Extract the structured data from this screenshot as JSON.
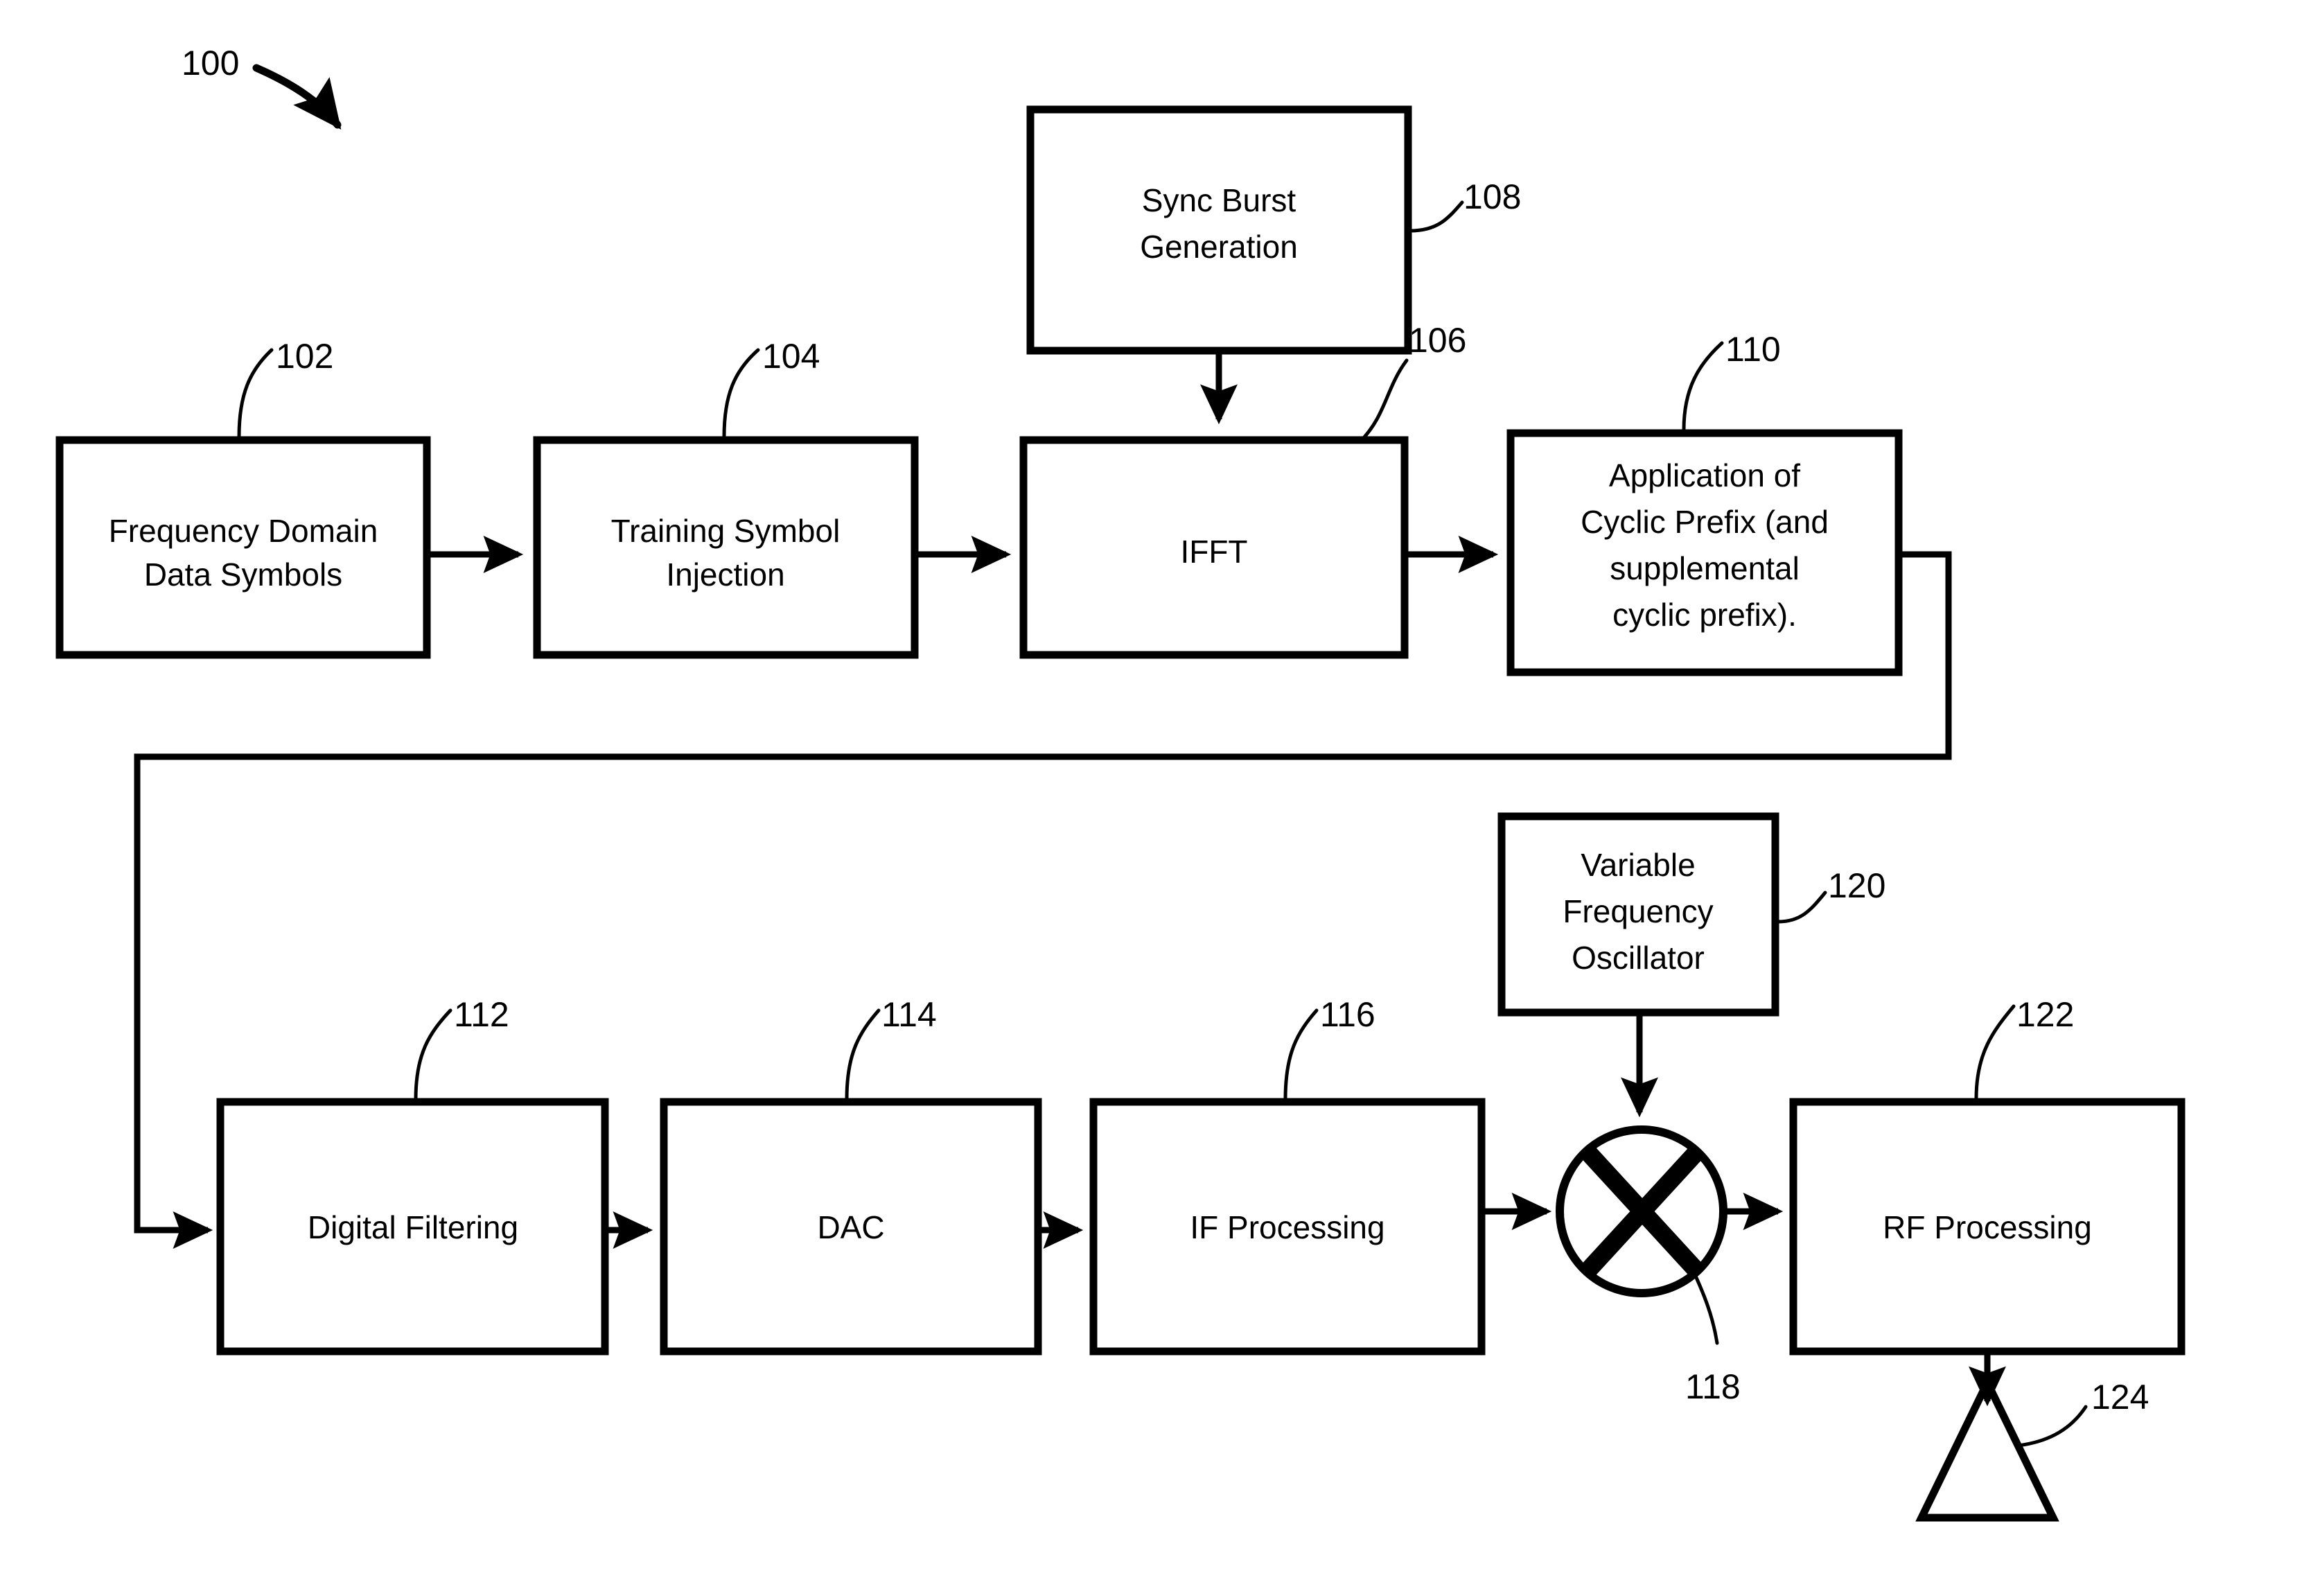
{
  "figure": {
    "figure_ref": "100",
    "blocks": [
      {
        "id": "b102",
        "ref": "102",
        "label_lines": [
          "Frequency Domain",
          "Data Symbols"
        ]
      },
      {
        "id": "b104",
        "ref": "104",
        "label_lines": [
          "Training Symbol",
          "Injection"
        ]
      },
      {
        "id": "b106",
        "ref": "106",
        "label_lines": [
          "IFFT"
        ]
      },
      {
        "id": "b108",
        "ref": "108",
        "label_lines": [
          "Sync Burst",
          "Generation"
        ]
      },
      {
        "id": "b110",
        "ref": "110",
        "label_lines": [
          "Application of",
          "Cyclic Prefix (and",
          "supplemental",
          "cyclic prefix)."
        ]
      },
      {
        "id": "b112",
        "ref": "112",
        "label_lines": [
          "Digital Filtering"
        ]
      },
      {
        "id": "b114",
        "ref": "114",
        "label_lines": [
          "DAC"
        ]
      },
      {
        "id": "b116",
        "ref": "116",
        "label_lines": [
          "IF Processing"
        ]
      },
      {
        "id": "b118",
        "ref": "118",
        "label_lines": [],
        "shape": "mixer-circle"
      },
      {
        "id": "b120",
        "ref": "120",
        "label_lines": [
          "Variable",
          "Frequency",
          "Oscillator"
        ]
      },
      {
        "id": "b122",
        "ref": "122",
        "label_lines": [
          "RF Processing"
        ]
      },
      {
        "id": "b124",
        "ref": "124",
        "label_lines": [],
        "shape": "antenna-triangle"
      }
    ],
    "text": {
      "freq_domain_l1": "Frequency Domain",
      "freq_domain_l2": "Data Symbols",
      "training_l1": "Training Symbol",
      "training_l2": "Injection",
      "ifft": "IFFT",
      "sync_l1": "Sync Burst",
      "sync_l2": "Generation",
      "cyclic_l1": "Application of",
      "cyclic_l2": "Cyclic Prefix (and",
      "cyclic_l3": "supplemental",
      "cyclic_l4": "cyclic prefix).",
      "digital_filtering": "Digital Filtering",
      "dac": "DAC",
      "if_processing": "IF Processing",
      "vfo_l1": "Variable",
      "vfo_l2": "Frequency",
      "vfo_l3": "Oscillator",
      "rf_processing": "RF Processing"
    },
    "refs": {
      "r100": "100",
      "r102": "102",
      "r104": "104",
      "r106": "106",
      "r108": "108",
      "r110": "110",
      "r112": "112",
      "r114": "114",
      "r116": "116",
      "r118": "118",
      "r120": "120",
      "r122": "122",
      "r124": "124"
    },
    "colors": {
      "ink": "#000000",
      "paper": "#ffffff"
    }
  }
}
